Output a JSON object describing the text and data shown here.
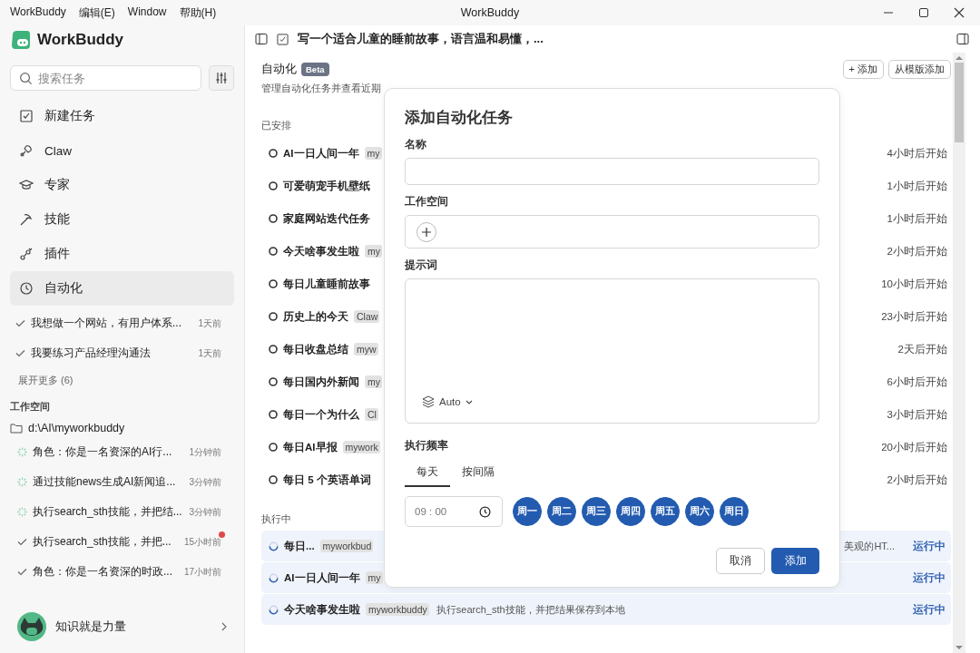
{
  "window": {
    "menu": [
      "WorkBuddy",
      "编辑(E)",
      "Window",
      "帮助(H)"
    ],
    "title": "WorkBuddy"
  },
  "sidebar": {
    "brand": "WorkBuddy",
    "search": {
      "placeholder": "搜索任务"
    },
    "nav": [
      {
        "label": "新建任务",
        "selected": false
      },
      {
        "label": "Claw",
        "selected": false
      },
      {
        "label": "专家",
        "selected": false
      },
      {
        "label": "技能",
        "selected": false
      },
      {
        "label": "插件",
        "selected": false
      },
      {
        "label": "自动化",
        "selected": true
      }
    ],
    "history": [
      {
        "title": "我想做一个网站，有用户体系...",
        "time": "1天前"
      },
      {
        "title": "我要练习产品经理沟通法",
        "time": "1天前"
      }
    ],
    "more": "展开更多 (6)",
    "workspace_label": "工作空间",
    "folder": "d:\\AI\\myworkbuddy",
    "tasks": [
      {
        "title": "角色：你是一名资深的AI行...",
        "time": "1分钟前",
        "kind": "running",
        "unread": false
      },
      {
        "title": "通过技能news生成AI新闻追...",
        "time": "3分钟前",
        "kind": "running",
        "unread": false
      },
      {
        "title": "执行search_sth技能，并把结...",
        "time": "3分钟前",
        "kind": "running",
        "unread": false
      },
      {
        "title": "执行search_sth技能，并把...",
        "time": "15小时前",
        "kind": "done",
        "unread": true
      },
      {
        "title": "角色：你是一名资深的时政...",
        "time": "17小时前",
        "kind": "done",
        "unread": false
      }
    ],
    "user": "知识就是力量"
  },
  "header": {
    "title": "写一个适合儿童的睡前故事，语言温和易懂，..."
  },
  "page": {
    "title": "自动化",
    "badge": "Beta",
    "subtitle": "管理自动化任务并查看近期",
    "buttons": [
      "+ 添加",
      "从模版添加"
    ],
    "scheduled_label": "已安排",
    "scheduled": [
      {
        "name": "AI一日人间一年",
        "tag": "my",
        "time": "4小时后开始"
      },
      {
        "name": "可爱萌宠手机壁纸",
        "time": "1小时后开始"
      },
      {
        "name": "家庭网站迭代任务",
        "time": "1小时后开始"
      },
      {
        "name": "今天啥事发生啦",
        "tag": "my",
        "time": "2小时后开始"
      },
      {
        "name": "每日儿童睡前故事",
        "time": "10小时后开始"
      },
      {
        "name": "历史上的今天",
        "tag": "Claw",
        "time": "23小时后开始"
      },
      {
        "name": "每日收盘总结",
        "tag": "myw",
        "time": "2天后开始"
      },
      {
        "name": "每日国内外新闻",
        "tag": "my",
        "time": "6小时后开始"
      },
      {
        "name": "每日一个为什么",
        "tag": "Cl",
        "time": "3小时后开始"
      },
      {
        "name": "每日AI早报",
        "tag": "mywork",
        "time": "20小时后开始"
      },
      {
        "name": "每日 5 个英语单词",
        "time": "2小时后开始"
      }
    ],
    "running_label": "执行中",
    "running": [
      {
        "name": "每日...",
        "tag": "myworkbud",
        "description_tail": "美观的HT...",
        "status": "运行中"
      },
      {
        "name": "AI一日人间一年",
        "tag": "my",
        "status": "运行中"
      },
      {
        "name": "今天啥事发生啦",
        "tag": "myworkbuddy",
        "description": "执行search_sth技能，并把结果保存到本地",
        "status": "运行中"
      }
    ]
  },
  "dialog": {
    "title": "添加自动化任务",
    "name_label": "名称",
    "workspace_label": "工作空间",
    "prompt_label": "提示词",
    "model": "Auto",
    "frequency_label": "执行频率",
    "tabs": [
      {
        "label": "每天",
        "selected": true
      },
      {
        "label": "按间隔",
        "selected": false
      }
    ],
    "time": "09 : 00",
    "days": [
      {
        "label": "周一",
        "selected": true
      },
      {
        "label": "周二",
        "selected": true
      },
      {
        "label": "周三",
        "selected": true
      },
      {
        "label": "周四",
        "selected": true
      },
      {
        "label": "周五",
        "selected": true
      },
      {
        "label": "周六",
        "selected": true
      },
      {
        "label": "周日",
        "selected": true
      }
    ],
    "buttons": [
      "取消",
      "添加"
    ]
  }
}
